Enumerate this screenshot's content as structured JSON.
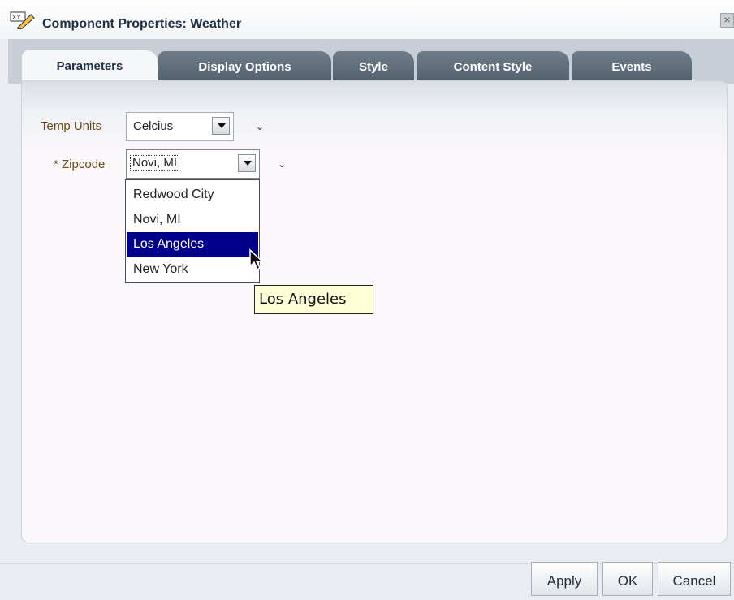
{
  "window": {
    "title": "Component Properties: Weather"
  },
  "tabs": [
    {
      "label": "Parameters",
      "active": true
    },
    {
      "label": "Display Options",
      "active": false
    },
    {
      "label": "Style",
      "active": false
    },
    {
      "label": "Content Style",
      "active": false
    },
    {
      "label": "Events",
      "active": false
    }
  ],
  "form": {
    "temp_units": {
      "label": "Temp Units",
      "value": "Celcius"
    },
    "zipcode": {
      "required_marker": "*",
      "label": "Zipcode",
      "value": "Novi, MI"
    },
    "dropdown_options": [
      "Redwood City",
      "Novi, MI",
      "Los Angeles",
      "New York"
    ],
    "highlighted_option": "Los Angeles",
    "tooltip": "Los Angeles"
  },
  "footer": {
    "apply_label": "Apply",
    "ok_label": "OK",
    "cancel_label": "Cancel"
  },
  "colors": {
    "selection": "#00008b",
    "tab_inactive": "#5f6c79",
    "label_text": "#6b4a16"
  },
  "icons": {
    "title": "edit-properties-icon",
    "close": "close-icon",
    "dropdown": "chevron-down-icon"
  }
}
